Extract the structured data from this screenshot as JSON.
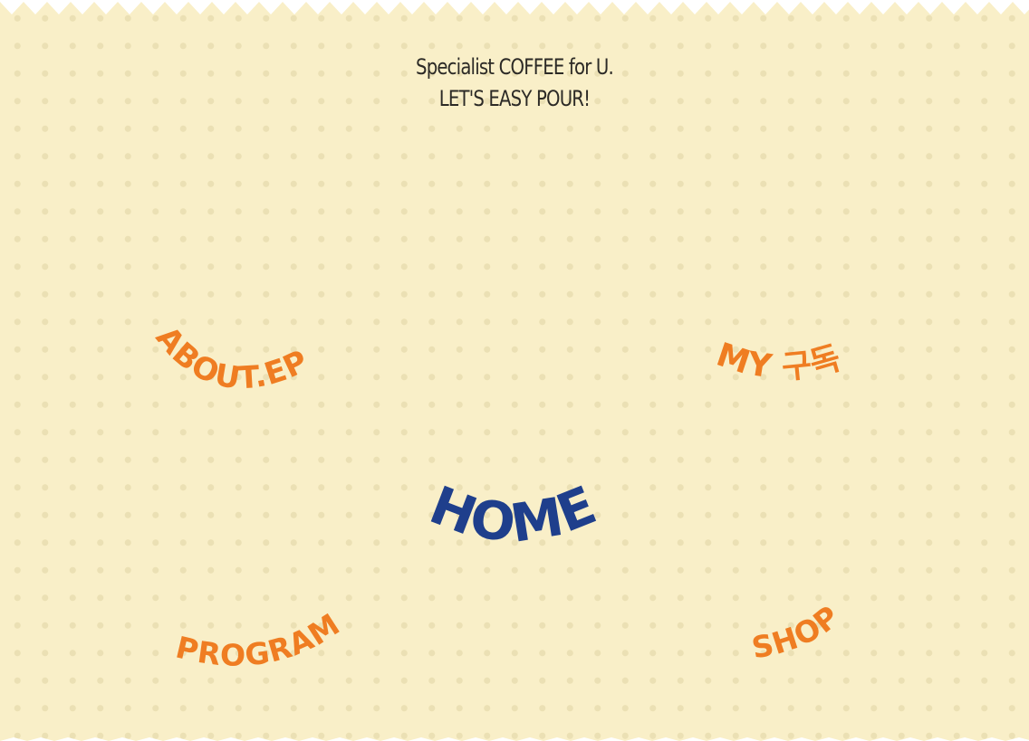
{
  "tagline": {
    "line1": "Specialist COFFEE for U.",
    "line2": "LET'S EASY POUR!"
  },
  "nav": {
    "about": "ABOUT.EP",
    "my_subscription": "MY 구독",
    "home": "HOME",
    "program": "PROGRAM",
    "shop": "SHOP"
  },
  "colors": {
    "background": "#f9efc8",
    "dot": "#ebe0b4",
    "nav_orange": "#ef7d22",
    "nav_home_blue": "#1f3f8c",
    "tagline_text": "#2c2a26"
  }
}
